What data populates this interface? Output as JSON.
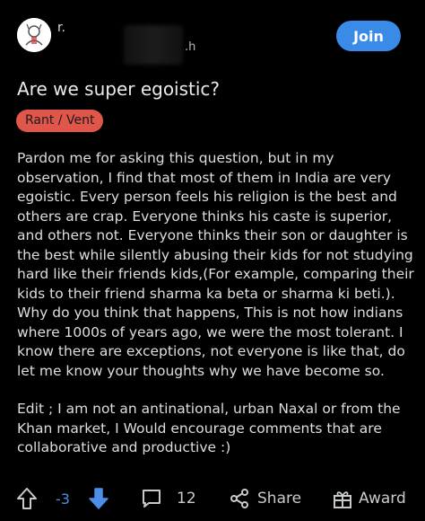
{
  "header": {
    "subreddit_initial": "r.",
    "author_suffix": ".h",
    "join_label": "Join"
  },
  "post": {
    "title": "Are we super egoistic?",
    "flair": "Rant / Vent",
    "body_paragraphs": [
      "Pardon me for asking this question, but in my observation, I find that most of them in India are very egoistic. Every person feels his religion is the best and others are crap. Everyone thinks his caste is superior, and others not. Everyone thinks their son or daughter is the best while silently abusing their kids for not studying hard like their friends kids,(For example, comparing their kids to their friend sharma ka beta or sharma ki beti.). Why do you think that happens, This is not how indians where 1000s of years ago, we were the most tolerant. I know there are exceptions, not everyone is like that, do let me know your thoughts why we have become so.",
      "Edit ; I am not an antinational, urban Naxal or from the Khan market, I Would encourage comments that are collaborative and productive :)"
    ]
  },
  "actions": {
    "vote_count": "-3",
    "comment_count": "12",
    "share_label": "Share",
    "award_label": "Award"
  },
  "colors": {
    "background": "#000000",
    "join_button": "#3a8be8",
    "flair_bg": "#e0564a",
    "downvote_active": "#4d8fe8"
  },
  "icons": {
    "upvote": "arrow-up-outline",
    "downvote": "arrow-down-filled",
    "comment": "speech-bubble",
    "share": "share-nodes",
    "award": "gift-box"
  }
}
